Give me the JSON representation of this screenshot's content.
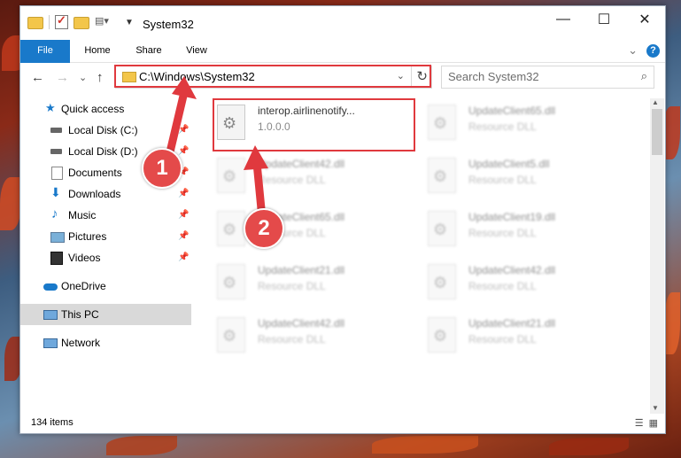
{
  "window": {
    "title": "System32",
    "min": "—",
    "max": "☐",
    "close": "✕"
  },
  "ribbon": {
    "tabs": [
      "File",
      "Home",
      "Share",
      "View"
    ],
    "expand": "⌄",
    "help": "?"
  },
  "nav": {
    "back": "←",
    "forward": "→",
    "recent": "⌄",
    "up": "↑",
    "address": "C:\\Windows\\System32",
    "address_dropdown": "⌄",
    "refresh": "↻",
    "search_placeholder": "Search System32",
    "search_icon": "⌕"
  },
  "sidebar": {
    "items": [
      {
        "label": "Quick access",
        "icon": "star-icon",
        "pinned": false
      },
      {
        "label": "Local Disk (C:)",
        "icon": "drive-icon",
        "pinned": true
      },
      {
        "label": "Local Disk (D:)",
        "icon": "drive-icon",
        "pinned": true
      },
      {
        "label": "Documents",
        "icon": "documents-icon",
        "pinned": true
      },
      {
        "label": "Downloads",
        "icon": "downloads-icon",
        "pinned": true
      },
      {
        "label": "Music",
        "icon": "music-icon",
        "pinned": true
      },
      {
        "label": "Pictures",
        "icon": "pictures-icon",
        "pinned": true
      },
      {
        "label": "Videos",
        "icon": "videos-icon",
        "pinned": true
      },
      {
        "label": "OneDrive",
        "icon": "onedrive-icon",
        "pinned": false
      },
      {
        "label": "This PC",
        "icon": "pc-icon",
        "pinned": false,
        "selected": true
      },
      {
        "label": "Network",
        "icon": "network-icon",
        "pinned": false
      }
    ],
    "pin_glyph": "📌"
  },
  "files": [
    {
      "name": "interop.airlinenotify...",
      "sub": "1.0.0.0"
    },
    {
      "name": "UpdateClient65.dll",
      "sub": "Resource DLL"
    },
    {
      "name": "UpdateClient42.dll",
      "sub": "Resource DLL"
    },
    {
      "name": "UpdateClient5.dll",
      "sub": "Resource DLL"
    },
    {
      "name": "UpdateClient65.dll",
      "sub": "Resource DLL"
    },
    {
      "name": "UpdateClient19.dll",
      "sub": "Resource DLL"
    },
    {
      "name": "UpdateClient21.dll",
      "sub": "Resource DLL"
    },
    {
      "name": "UpdateClient42.dll",
      "sub": "Resource DLL"
    },
    {
      "name": "UpdateClient42.dll",
      "sub": "Resource DLL"
    },
    {
      "name": "UpdateClient21.dll",
      "sub": "Resource DLL"
    }
  ],
  "status": {
    "items_count": "134 items",
    "details_view": "☰",
    "tiles_view": "▦"
  },
  "annotations": {
    "step1": "1",
    "step2": "2",
    "color": "#e0393e"
  }
}
